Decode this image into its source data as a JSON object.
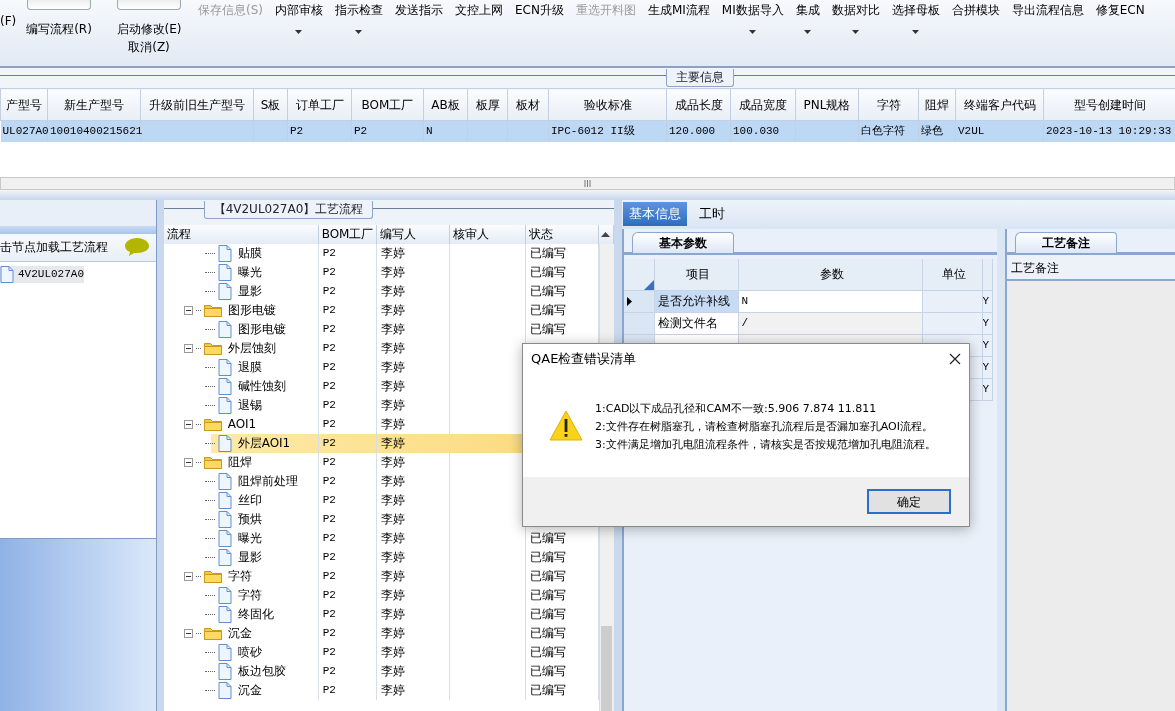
{
  "toolbar": {
    "edge_text": "(F)",
    "left_buttons": [
      {
        "label": "编写流程(R)"
      },
      {
        "label": "启动修改(E)",
        "second_label": "取消(Z)"
      }
    ],
    "buttons": [
      {
        "label": "保存信息(S)",
        "disabled": true,
        "dropdown": false
      },
      {
        "label": "内部审核",
        "disabled": false,
        "dropdown": true
      },
      {
        "label": "指示检查",
        "disabled": false,
        "dropdown": true
      },
      {
        "label": "发送指示",
        "disabled": false,
        "dropdown": false
      },
      {
        "label": "文控上网",
        "disabled": false,
        "dropdown": false
      },
      {
        "label": "ECN升级",
        "disabled": false,
        "dropdown": false
      },
      {
        "label": "重选开料图",
        "disabled": true,
        "dropdown": false
      },
      {
        "label": "生成MI流程",
        "disabled": false,
        "dropdown": false
      },
      {
        "label": "MI数据导入",
        "disabled": false,
        "dropdown": true
      },
      {
        "label": "集成",
        "disabled": false,
        "dropdown": true
      },
      {
        "label": "数据对比",
        "disabled": false,
        "dropdown": true
      },
      {
        "label": "选择母板",
        "disabled": false,
        "dropdown": true
      },
      {
        "label": "合拼模块",
        "disabled": false,
        "dropdown": false
      },
      {
        "label": "导出流程信息",
        "disabled": false,
        "dropdown": false
      },
      {
        "label": "修复ECN",
        "disabled": false,
        "dropdown": false
      }
    ],
    "toggles": [
      {
        "on": false
      },
      {
        "on": false
      }
    ]
  },
  "main_info": {
    "title": "主要信息",
    "columns": [
      "产型号",
      "新生产型号",
      "升级前旧生产型号",
      "S板",
      "订单工厂",
      "BOM工厂",
      "AB板",
      "板厚",
      "板材",
      "验收标准",
      "成品长度",
      "成品宽度",
      "PNL规格",
      "字符",
      "阻焊",
      "终端客户代码",
      "型号创建时间"
    ],
    "rows": [
      {
        "selected": true,
        "cells": [
          "UL027A0",
          "10010400215621",
          null,
          null,
          "P2",
          "P2",
          "N",
          null,
          null,
          "IPC-6012 II级",
          "120.000",
          "100.030",
          null,
          "白色字符",
          "绿色",
          "V2UL",
          "2023-10-13 10:29:33"
        ]
      }
    ]
  },
  "node_panel": {
    "hint": "击节点加载工艺流程",
    "items": [
      {
        "label": "4V2UL027A0",
        "selected": true
      }
    ]
  },
  "process_panel": {
    "title": "【4V2UL027A0】工艺流程",
    "columns": [
      "流程",
      "BOM工厂",
      "编写人",
      "核审人",
      "状态"
    ],
    "groups": [
      {
        "children": [
          {
            "label": "贴膜",
            "factory": "P2",
            "writer": "李婷",
            "status": "已编写",
            "selected": false
          },
          {
            "label": "曝光",
            "factory": "P2",
            "writer": "李婷",
            "status": "已编写",
            "selected": false
          },
          {
            "label": "显影",
            "factory": "P2",
            "writer": "李婷",
            "status": "已编写",
            "selected": false
          }
        ]
      },
      {
        "label": "图形电镀",
        "factory": "P2",
        "writer": "李婷",
        "status": "已编写",
        "expanded": true,
        "selected": false,
        "children": [
          {
            "label": "图形电镀",
            "factory": "P2",
            "writer": "李婷",
            "status": "已编写",
            "selected": false
          }
        ]
      },
      {
        "label": "外层蚀刻",
        "factory": "P2",
        "writer": "李婷",
        "expanded": true,
        "selected": false,
        "children": [
          {
            "label": "退膜",
            "factory": "P2",
            "writer": "李婷",
            "selected": false
          },
          {
            "label": "碱性蚀刻",
            "factory": "P2",
            "writer": "李婷",
            "selected": false
          },
          {
            "label": "退锡",
            "factory": "P2",
            "writer": "李婷",
            "selected": false
          }
        ]
      },
      {
        "label": "AOI1",
        "factory": "P2",
        "writer": "李婷",
        "expanded": true,
        "selected": false,
        "children": [
          {
            "label": "外层AOI1",
            "factory": "P2",
            "writer": "李婷",
            "selected": true
          }
        ]
      },
      {
        "label": "阻焊",
        "factory": "P2",
        "writer": "李婷",
        "expanded": true,
        "selected": false,
        "children": [
          {
            "label": "阻焊前处理",
            "factory": "P2",
            "writer": "李婷",
            "selected": false
          },
          {
            "label": "丝印",
            "factory": "P2",
            "writer": "李婷",
            "selected": false
          },
          {
            "label": "预烘",
            "factory": "P2",
            "writer": "李婷",
            "selected": false
          },
          {
            "label": "曝光",
            "factory": "P2",
            "writer": "李婷",
            "status": "已编写",
            "selected": false
          },
          {
            "label": "显影",
            "factory": "P2",
            "writer": "李婷",
            "status": "已编写",
            "selected": false
          }
        ]
      },
      {
        "label": "字符",
        "factory": "P2",
        "writer": "李婷",
        "status": "已编写",
        "expanded": true,
        "selected": false,
        "children": [
          {
            "label": "字符",
            "factory": "P2",
            "writer": "李婷",
            "status": "已编写",
            "selected": false
          },
          {
            "label": "终固化",
            "factory": "P2",
            "writer": "李婷",
            "status": "已编写",
            "selected": false
          }
        ]
      },
      {
        "label": "沉金",
        "factory": "P2",
        "writer": "李婷",
        "status": "已编写",
        "expanded": true,
        "selected": false,
        "children": [
          {
            "label": "喷砂",
            "factory": "P2",
            "writer": "李婷",
            "status": "已编写",
            "selected": false
          },
          {
            "label": "板边包胶",
            "factory": "P2",
            "writer": "李婷",
            "status": "已编写",
            "selected": false
          },
          {
            "label": "沉金",
            "factory": "P2",
            "writer": "李婷",
            "status": "已编写",
            "selected": false
          }
        ]
      }
    ]
  },
  "detail_tabs": [
    {
      "label": "基本信息",
      "selected": true
    },
    {
      "label": "工时",
      "selected": false
    }
  ],
  "params": {
    "tab": "基本参数",
    "columns": [
      "项目",
      "参数",
      "单位"
    ],
    "rows": [
      {
        "item": "是否允许补线",
        "value": "N",
        "column_5": "Y",
        "selected": true
      },
      {
        "item": "检测文件名",
        "value": "/",
        "column_5": "Y",
        "selected": false
      },
      {
        "column_5": "Y"
      },
      {
        "column_5": "Y"
      },
      {
        "column_5": "Y"
      }
    ]
  },
  "remarks": {
    "tab": "工艺备注",
    "label": "工艺备注"
  },
  "dialog": {
    "title": "QAE检查错误清单",
    "messages": [
      "1:CAD以下成品孔径和CAM不一致:5.906 7.874 11.811",
      "2:文件存在树脂塞孔，请检查树脂塞孔流程后是否漏加塞孔AOI流程。",
      "3:文件满足增加孔电阻流程条件，请核实是否按规范增加孔电阻流程。"
    ],
    "button": "确定"
  }
}
